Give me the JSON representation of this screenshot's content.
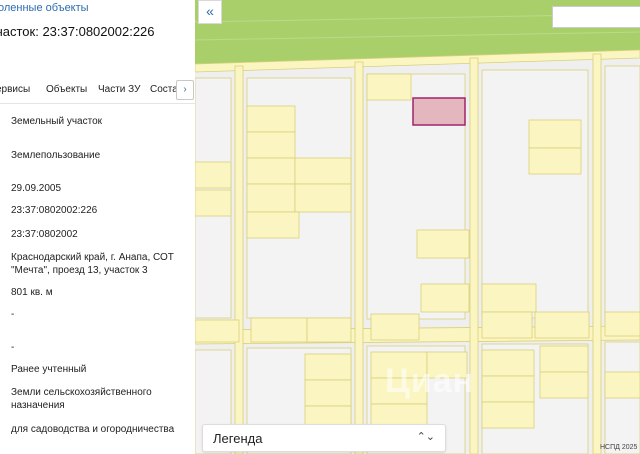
{
  "panel": {
    "header_link": "оленные объекты",
    "title": "часток: 23:37:0802002:226",
    "tabs": [
      {
        "label": "ервисы"
      },
      {
        "label": "Объекты"
      },
      {
        "label": "Части ЗУ"
      },
      {
        "label": "Соста"
      }
    ],
    "tabs_more": "›",
    "values": [
      "Земельный участок",
      "Землепользование",
      "29.09.2005",
      "23:37:0802002:226",
      "23:37:0802002",
      "Краснодарский край, г. Анапа, СОТ \"Мечта\", проезд 13, участок 3",
      "801 кв. м",
      "-",
      "-",
      "Ранее учтенный",
      "Земли сельскохозяйственного назначения",
      "для садоводства и огородничества"
    ]
  },
  "map": {
    "collapse_icon": "«",
    "legend_label": "Легенда",
    "legend_chevron": "⌃⌄",
    "attribution": "НСПД 2025",
    "watermark": "Циан",
    "colors": {
      "field_green": "#a9cf6b",
      "plot_yellow": "#fbf5c2",
      "plot_border": "#d9d07a",
      "road_gray": "#efefef",
      "selected_fill": "#e3b7bd",
      "selected_border": "#a0246c"
    }
  }
}
